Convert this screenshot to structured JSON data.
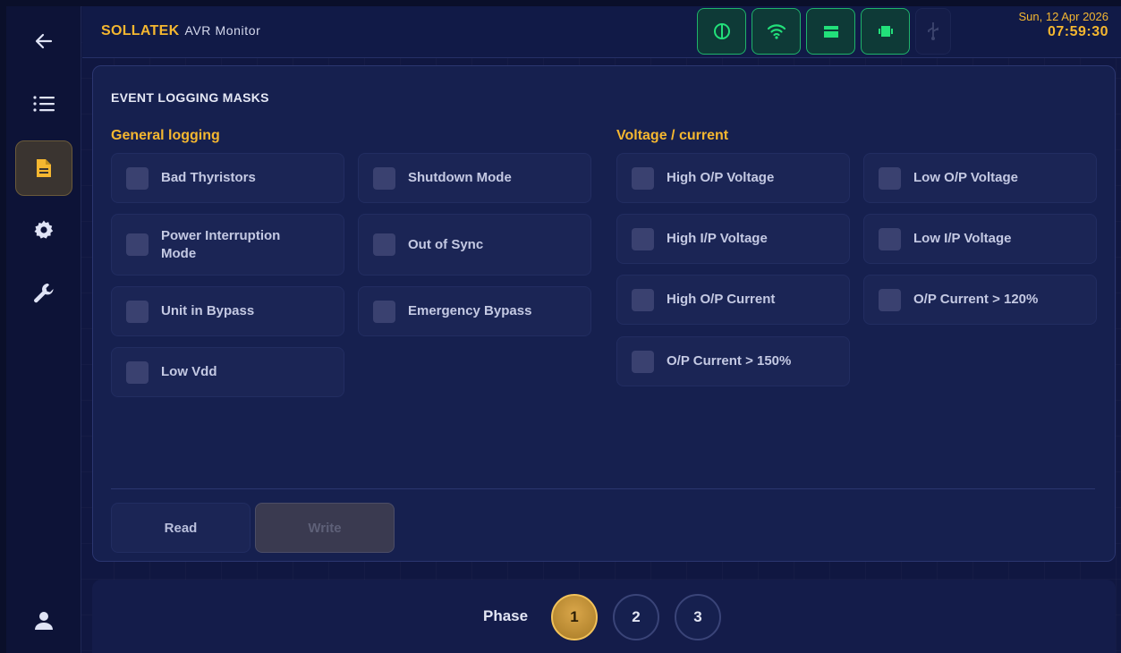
{
  "header": {
    "brand": "SOLLATEK",
    "subtitle": "AVR Monitor",
    "date": "Sun, 12 Apr 2026",
    "time": "07:59:30",
    "status_icons": [
      {
        "name": "power-icon",
        "state": "active"
      },
      {
        "name": "wifi-icon",
        "state": "active"
      },
      {
        "name": "battery-icon",
        "state": "active"
      },
      {
        "name": "device-icon",
        "state": "active"
      },
      {
        "name": "usb-icon",
        "state": "inactive"
      }
    ]
  },
  "sidebar": {
    "items": [
      {
        "icon": "back-arrow-icon",
        "active": false
      },
      {
        "icon": "list-icon",
        "active": false
      },
      {
        "icon": "document-icon",
        "active": true
      },
      {
        "icon": "gear-icon",
        "active": false
      },
      {
        "icon": "wrench-icon",
        "active": false
      },
      {
        "icon": "user-icon",
        "active": false
      }
    ]
  },
  "panel": {
    "title": "EVENT LOGGING MASKS",
    "general": {
      "title": "General logging",
      "items": [
        {
          "label": "Bad Thyristors",
          "checked": false
        },
        {
          "label": "Shutdown Mode",
          "checked": false
        },
        {
          "label": "Power Interruption Mode",
          "checked": false
        },
        {
          "label": "Out of Sync",
          "checked": false
        },
        {
          "label": "Unit in Bypass",
          "checked": false
        },
        {
          "label": "Emergency Bypass",
          "checked": false
        },
        {
          "label": "Low Vdd",
          "checked": false
        }
      ]
    },
    "voltage": {
      "title": "Voltage / current",
      "items": [
        {
          "label": "High O/P Voltage",
          "checked": false
        },
        {
          "label": "Low O/P Voltage",
          "checked": false
        },
        {
          "label": "High I/P Voltage",
          "checked": false
        },
        {
          "label": "Low I/P Voltage",
          "checked": false
        },
        {
          "label": "High O/P Current",
          "checked": false
        },
        {
          "label": "O/P Current > 120%",
          "checked": false
        },
        {
          "label": "O/P Current > 150%",
          "checked": false
        }
      ]
    },
    "buttons": {
      "read": "Read",
      "write": "Write"
    }
  },
  "phase": {
    "label": "Phase",
    "options": [
      "1",
      "2",
      "3"
    ],
    "selected": "1"
  },
  "colors": {
    "accent": "#f5b730",
    "status_green": "#1fb36a",
    "background": "#101741"
  }
}
